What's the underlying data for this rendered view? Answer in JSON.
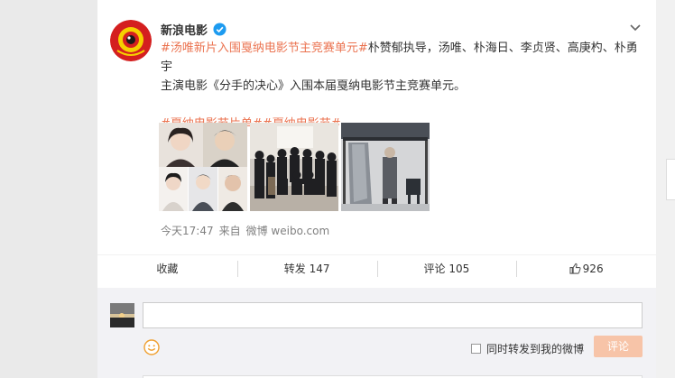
{
  "post": {
    "author": "新浪电影",
    "topic_main": "#汤唯新片入围戛纳电影节主竞赛单元#",
    "text_line1": "朴赞郁执导，汤唯、朴海日、李贞贤、高庚杓、朴勇宇",
    "text_line2": "主演电影《分手的决心》入围本届戛纳电影节主竞赛单元。",
    "topic_tag1": "#戛纳电影节片单#",
    "topic_tag2": "#戛纳电影节#",
    "time": "今天17:47",
    "source_prefix": "来自",
    "source": "微博 weibo.com"
  },
  "actions": {
    "favorite": "收藏",
    "repost": "转发 147",
    "comment": "评论 105",
    "like_count": "926"
  },
  "comment_box": {
    "placeholder": "",
    "repost_label": "同时转发到我的微博",
    "submit_label": "评论"
  },
  "colors": {
    "topic": "#eb7350",
    "submit_bg": "#f7c4a8",
    "page_bg": "#eaeaea"
  },
  "icons": {
    "verified": "verified-badge-icon",
    "more": "chevron-down-icon",
    "like": "thumbs-up-icon",
    "emoji": "smiley-icon"
  }
}
